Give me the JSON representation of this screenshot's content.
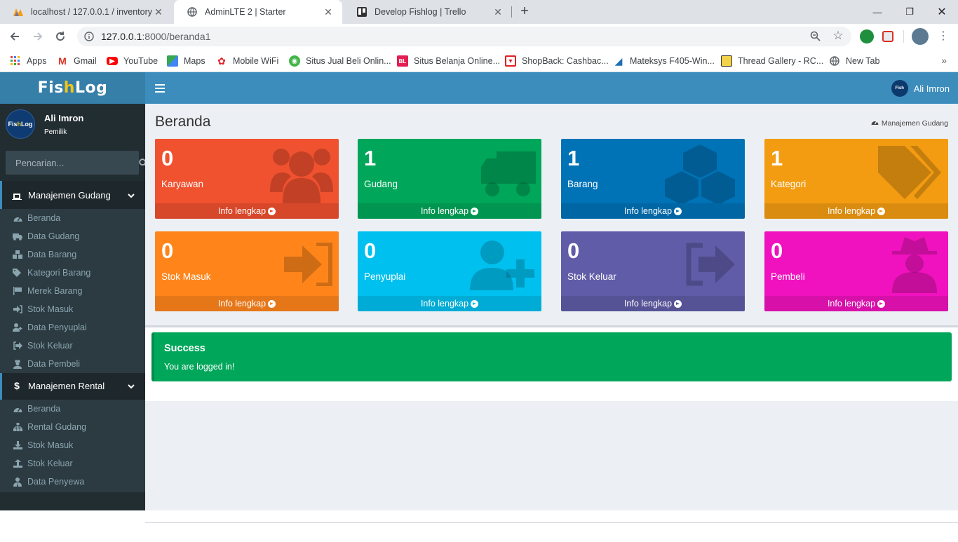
{
  "browser": {
    "tabs": [
      {
        "title": "localhost / 127.0.0.1 / inventory |",
        "icon": "phpmyadmin-icon"
      },
      {
        "title": "AdminLTE 2 | Starter",
        "icon": "globe-icon"
      },
      {
        "title": "Develop Fishlog | Trello",
        "icon": "trello-icon"
      }
    ],
    "url_host": "127.0.0.1",
    "url_rest": ":8000/beranda1",
    "bookmarks": [
      {
        "label": "Apps",
        "icon": "apps-grid-icon"
      },
      {
        "label": "Gmail",
        "icon": "gmail-icon"
      },
      {
        "label": "YouTube",
        "icon": "youtube-icon"
      },
      {
        "label": "Maps",
        "icon": "maps-icon"
      },
      {
        "label": "Mobile WiFi",
        "icon": "huawei-icon"
      },
      {
        "label": "Situs Jual Beli Onlin...",
        "icon": "tokopedia-icon"
      },
      {
        "label": "Situs Belanja Online...",
        "icon": "bukalapak-icon"
      },
      {
        "label": "ShopBack: Cashbac...",
        "icon": "shopback-icon"
      },
      {
        "label": "Mateksys F405-Win...",
        "icon": "mateksys-icon"
      },
      {
        "label": "Thread Gallery - RC...",
        "icon": "robot-icon"
      },
      {
        "label": "New Tab",
        "icon": "globe-icon"
      }
    ]
  },
  "app": {
    "logo": {
      "part1": "Fis",
      "part2": "h",
      "part3": "Log"
    },
    "user_name": "Ali Imron",
    "user_role": "Pemilik",
    "search_placeholder": "Pencarian...",
    "menus": [
      {
        "title": "Manajemen Gudang",
        "icon": "warehouse-icon",
        "items": [
          {
            "label": "Beranda",
            "icon": "dashboard-icon"
          },
          {
            "label": "Data Gudang",
            "icon": "truck-icon"
          },
          {
            "label": "Data Barang",
            "icon": "cubes-icon"
          },
          {
            "label": "Kategori Barang",
            "icon": "tags-icon"
          },
          {
            "label": "Merek Barang",
            "icon": "flag-icon"
          },
          {
            "label": "Stok Masuk",
            "icon": "sign-in-icon"
          },
          {
            "label": "Data Penyuplai",
            "icon": "user-plus-icon"
          },
          {
            "label": "Stok Keluar",
            "icon": "sign-out-icon"
          },
          {
            "label": "Data Pembeli",
            "icon": "user-secret-icon"
          }
        ]
      },
      {
        "title": "Manajemen Rental",
        "icon": "dollar-icon",
        "items": [
          {
            "label": "Beranda",
            "icon": "dashboard-icon"
          },
          {
            "label": "Rental Gudang",
            "icon": "sitemap-icon"
          },
          {
            "label": "Stok Masuk",
            "icon": "download-icon"
          },
          {
            "label": "Stok Keluar",
            "icon": "upload-icon"
          },
          {
            "label": "Data Penyewa",
            "icon": "user-tie-icon"
          }
        ]
      }
    ],
    "page_title": "Beranda",
    "breadcrumb": "Manajemen Gudang",
    "boxes": [
      {
        "value": "0",
        "label": "Karyawan",
        "color": "#f0512f",
        "icon": "users-icon"
      },
      {
        "value": "1",
        "label": "Gudang",
        "color": "#00a65a",
        "icon": "truck-icon"
      },
      {
        "value": "1",
        "label": "Barang",
        "color": "#0073b7",
        "icon": "cubes-icon"
      },
      {
        "value": "1",
        "label": "Kategori",
        "color": "#f39c12",
        "icon": "tags-icon"
      },
      {
        "value": "0",
        "label": "Stok Masuk",
        "color": "#ff851b",
        "icon": "sign-in-icon"
      },
      {
        "value": "0",
        "label": "Penyuplai",
        "color": "#00c0ef",
        "icon": "user-plus-icon"
      },
      {
        "value": "0",
        "label": "Stok Keluar",
        "color": "#605ca8",
        "icon": "sign-out-icon"
      },
      {
        "value": "0",
        "label": "Pembeli",
        "color": "#f012be",
        "icon": "user-secret-icon"
      }
    ],
    "box_link": "Info lengkap",
    "alert_title": "Success",
    "alert_message": "You are logged in!"
  }
}
